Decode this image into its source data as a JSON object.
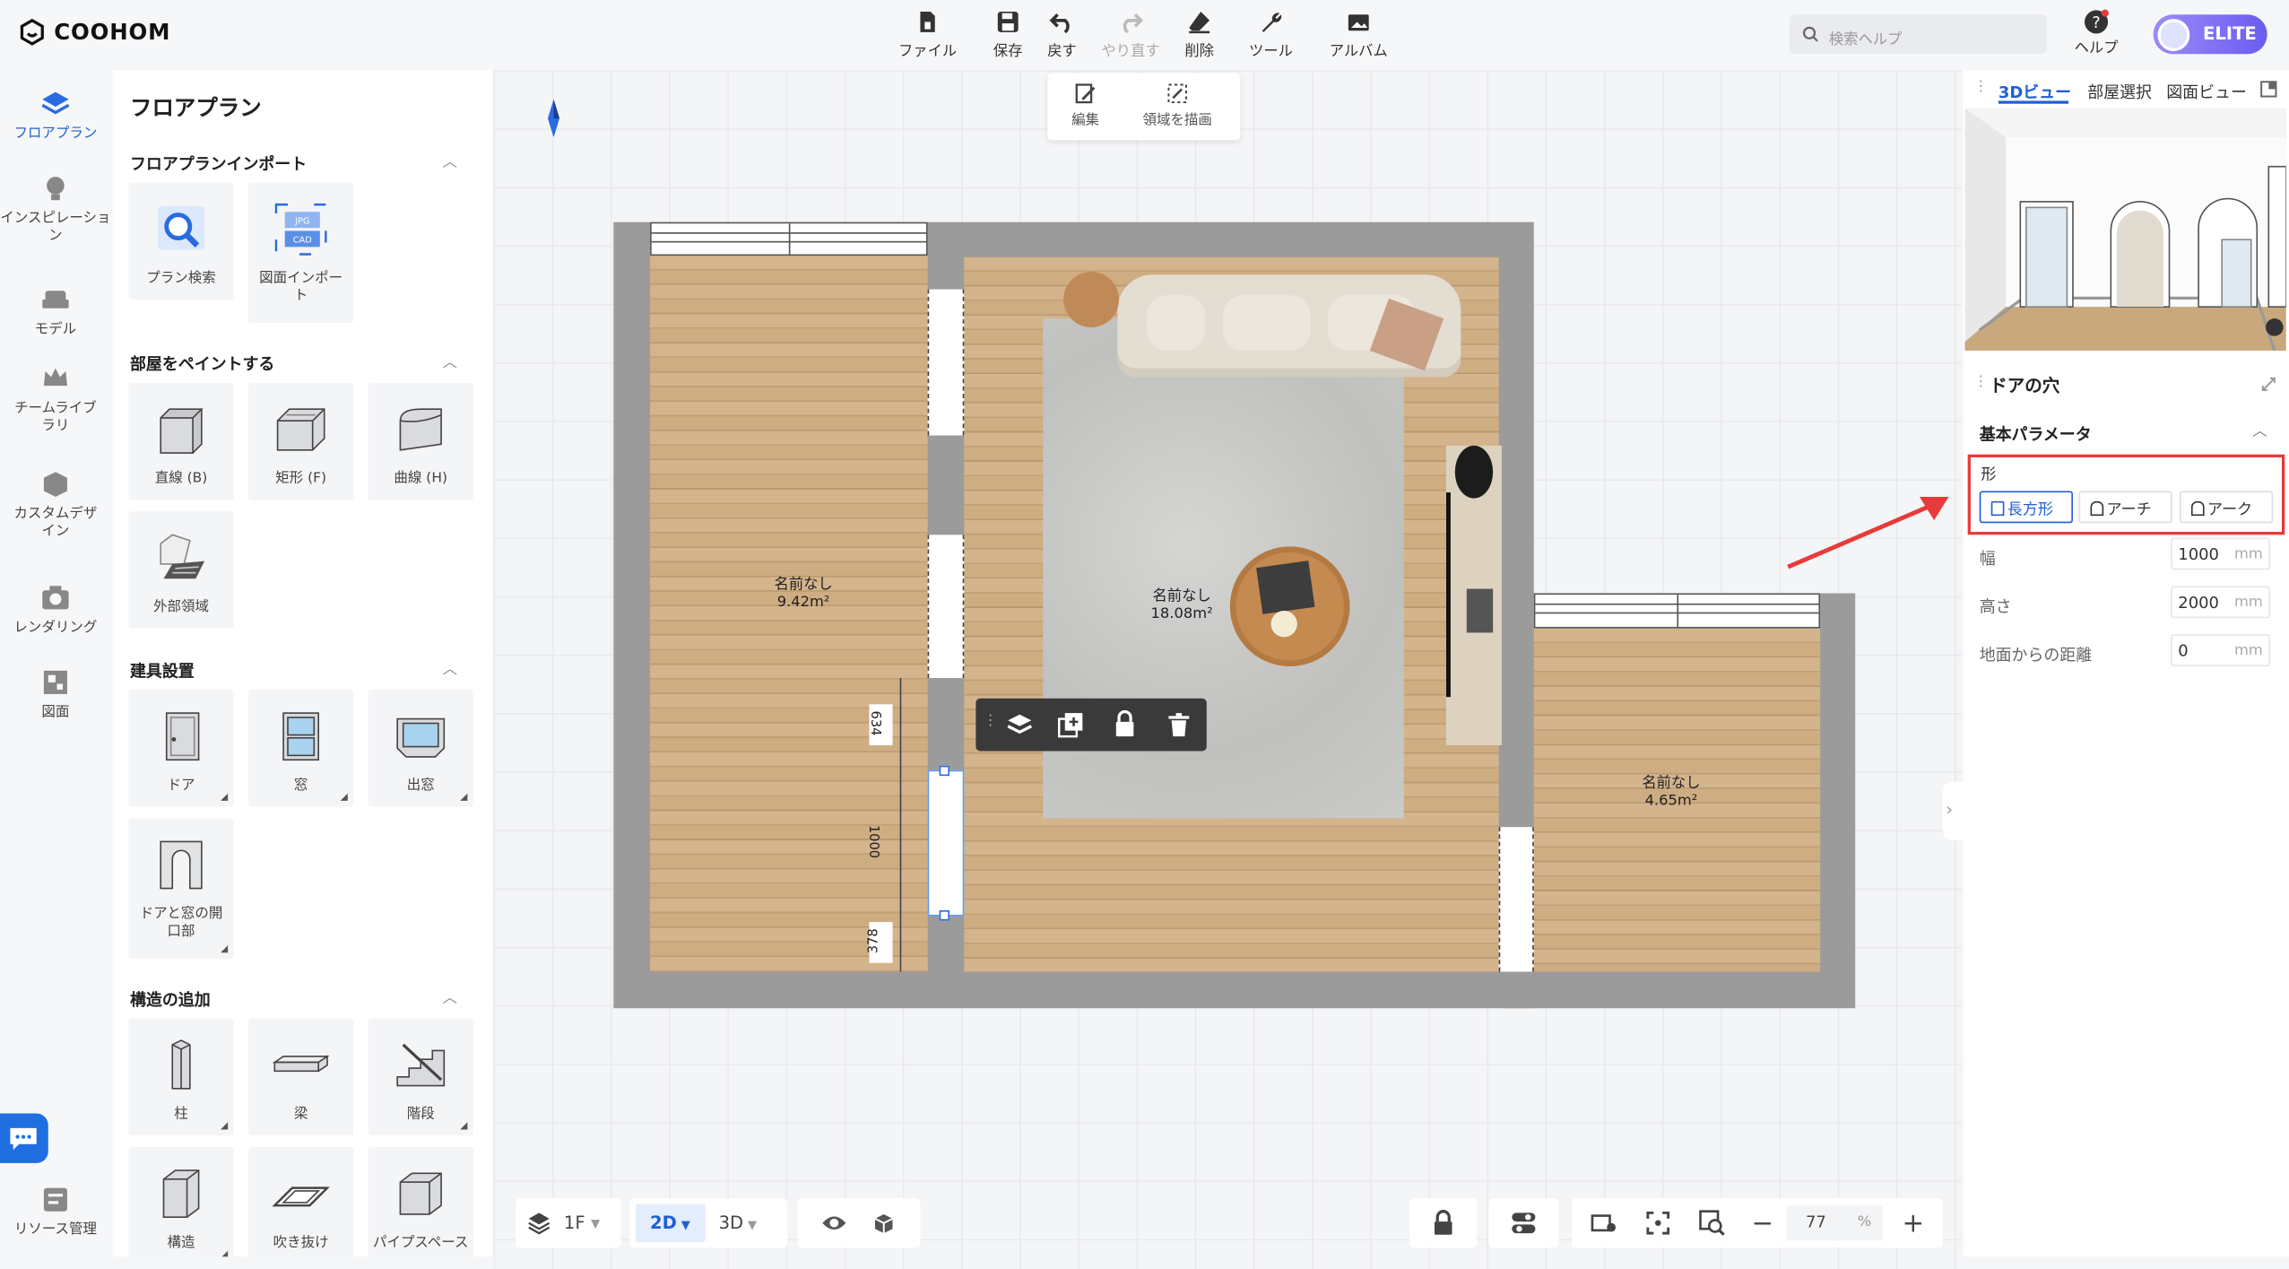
{
  "app": {
    "brand": "COOHOM"
  },
  "toolbar": {
    "file": "ファイル",
    "save": "保存",
    "undo": "戻す",
    "redo": "やり直す",
    "delete": "削除",
    "tools": "ツール",
    "album": "アルバム"
  },
  "search": {
    "placeholder": "検索ヘルプ"
  },
  "help": {
    "label": "ヘルプ"
  },
  "account": {
    "badge": "ELITE"
  },
  "leftnav": [
    {
      "label": "フロアプラン",
      "icon": "floorplan-icon"
    },
    {
      "label": "インスピレーション",
      "icon": "lightbulb-icon"
    },
    {
      "label": "モデル",
      "icon": "sofa-icon"
    },
    {
      "label": "チームライブラリ",
      "icon": "crown-icon"
    },
    {
      "label": "カスタムデザイン",
      "icon": "custom-box-icon"
    },
    {
      "label": "レンダリング",
      "icon": "camera-icon"
    },
    {
      "label": "図面",
      "icon": "drawing-icon"
    },
    {
      "label": "リソース管理",
      "icon": "resource-icon"
    }
  ],
  "panel": {
    "title": "フロアプラン",
    "sections": {
      "import": "フロアプランインポート",
      "paint": "部屋をペイントする",
      "fixtures": "建具設置",
      "structure": "構造の追加"
    },
    "import_items": [
      "プラン検索",
      "図面インポート"
    ],
    "paint_items": [
      "直線 (B)",
      "矩形 (F)",
      "曲線 (H)",
      "外部領域"
    ],
    "fixture_items": [
      "ドア",
      "窓",
      "出窓",
      "ドアと窓の開口部"
    ],
    "structure_items": [
      "柱",
      "梁",
      "階段",
      "構造",
      "吹き抜け",
      "パイプスペース"
    ]
  },
  "canvas": {
    "edit": "編集",
    "draw_area": "領域を描画",
    "rooms": [
      {
        "name": "名前なし",
        "area": "9.42m²"
      },
      {
        "name": "名前なし",
        "area": "18.08m²"
      },
      {
        "name": "名前なし",
        "area": "4.65m²"
      }
    ],
    "dims": [
      "634",
      "1000",
      "378"
    ]
  },
  "bottom": {
    "floor": "1F",
    "view2d": "2D",
    "view3d": "3D",
    "zoom": "77",
    "zoom_unit": "%"
  },
  "rightpanel": {
    "tabs": [
      "3Dビュー",
      "部屋選択",
      "図面ビュー"
    ],
    "object_title": "ドアの穴",
    "section": "基本パラメータ",
    "shape_label": "形",
    "shapes": [
      "長方形",
      "アーチ",
      "アーク"
    ],
    "selected_shape": "長方形",
    "params": [
      {
        "label": "幅",
        "value": "1000",
        "unit": "mm"
      },
      {
        "label": "高さ",
        "value": "2000",
        "unit": "mm"
      },
      {
        "label": "地面からの距離",
        "value": "0",
        "unit": "mm"
      }
    ]
  },
  "colors": {
    "accent": "#1f5fd6",
    "highlight": "#e83a3a",
    "wall": "#9b9b9b"
  }
}
